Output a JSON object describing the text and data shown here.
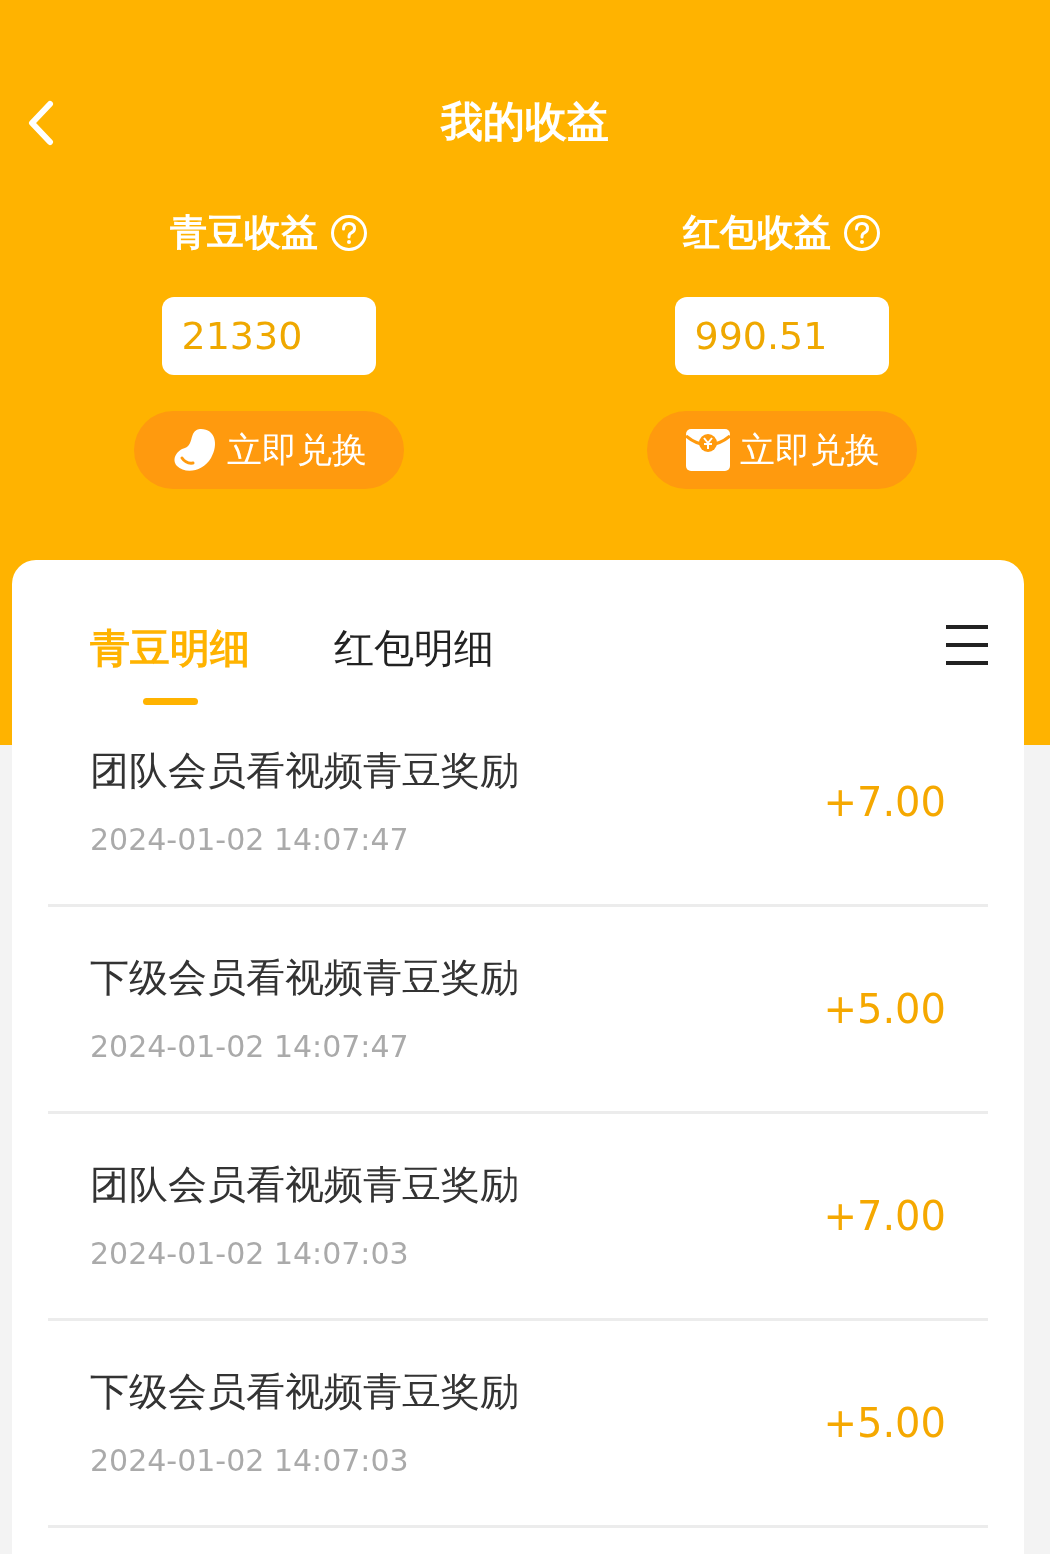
{
  "header": {
    "title": "我的收益"
  },
  "balances": [
    {
      "kind": "bean",
      "label": "青豆收益",
      "value": "21330",
      "button": "立即兑换"
    },
    {
      "kind": "envelope",
      "label": "红包收益",
      "value": "990.51",
      "button": "立即兑换"
    }
  ],
  "tabs": [
    {
      "label": "青豆明细",
      "selected": true
    },
    {
      "label": "红包明细",
      "selected": false
    }
  ],
  "records": [
    {
      "title": "团队会员看视频青豆奖励",
      "time": "2024-01-02 14:07:47",
      "amount": "+7.00"
    },
    {
      "title": "下级会员看视频青豆奖励",
      "time": "2024-01-02 14:07:47",
      "amount": "+5.00"
    },
    {
      "title": "团队会员看视频青豆奖励",
      "time": "2024-01-02 14:07:03",
      "amount": "+7.00"
    },
    {
      "title": "下级会员看视频青豆奖励",
      "time": "2024-01-02 14:07:03",
      "amount": "+5.00"
    }
  ]
}
